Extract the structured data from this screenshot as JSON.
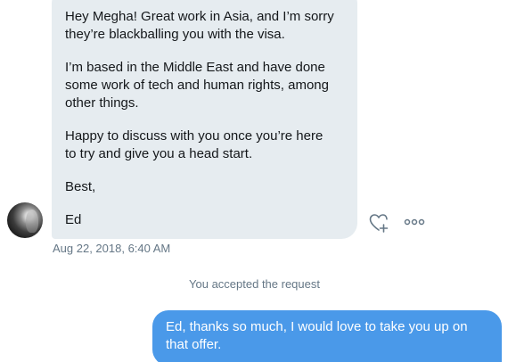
{
  "conversation": {
    "incoming_message": {
      "paragraphs": [
        "Hey Megha! Great work in Asia, and I’m sorry\nthey’re blackballing you with the visa.",
        "I’m based in the Middle East and have done\nsome work of tech and human rights, among\nother things.",
        "Happy to discuss with you once you’re here\nto try and give you a head start.",
        "Best,",
        "Ed"
      ],
      "timestamp": "Aug 22, 2018, 6:40 AM",
      "like_icon": "heart-plus-icon",
      "more_icon": "more-dots-icon"
    },
    "system_note": "You accepted the request",
    "outgoing_message": {
      "text": "Ed, thanks so much, I would love to take you up on\nthat offer."
    }
  },
  "colors": {
    "incoming_bubble": "#e6ecf0",
    "outgoing_bubble": "#4a99e9",
    "secondary_text": "#657786",
    "icon": "#657786"
  }
}
